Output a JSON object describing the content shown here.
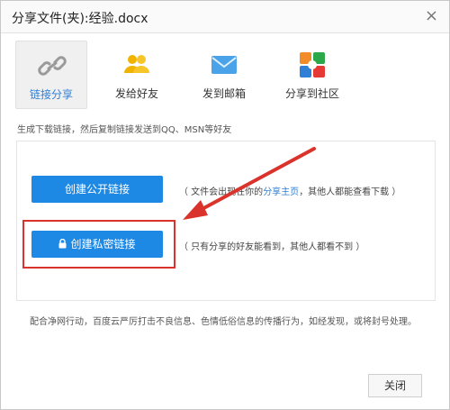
{
  "window": {
    "title": "分享文件(夹):经验.docx",
    "close_glyph": "×"
  },
  "tabs": [
    {
      "label": "链接分享",
      "icon": "link-icon",
      "active": true
    },
    {
      "label": "发给好友",
      "icon": "friends-icon",
      "active": false
    },
    {
      "label": "发到邮箱",
      "icon": "mail-icon",
      "active": false
    },
    {
      "label": "分享到社区",
      "icon": "community-icon",
      "active": false
    }
  ],
  "hint": "生成下载链接，然后复制链接发送到QQ、MSN等好友",
  "public_link": {
    "button_label": "创建公开链接",
    "desc_before": "（ 文件会出现在你的",
    "desc_link": "分享主页",
    "desc_after": "，其他人都能查看下载 ）"
  },
  "private_link": {
    "button_label": "创建私密链接",
    "desc": "（ 只有分享的好友能看到，其他人都看不到 ）"
  },
  "notice": "配合净网行动，百度云严厉打击不良信息、色情低俗信息的传播行为，如经发现，或将封号处理。",
  "footer": {
    "close_label": "关闭"
  },
  "colors": {
    "primary_button": "#1e88e5",
    "highlight": "#d9332b",
    "link": "#2f7fd6"
  }
}
